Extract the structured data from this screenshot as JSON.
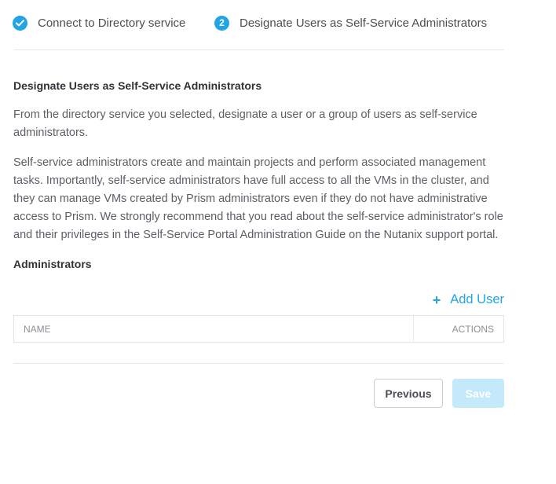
{
  "stepper": {
    "steps": [
      {
        "label": "Connect to Directory service",
        "state": "complete",
        "icon": "checkmark-icon"
      },
      {
        "number": "2",
        "label": "Designate Users as Self-Service Administrators",
        "state": "active"
      }
    ]
  },
  "section": {
    "title": "Designate Users as Self-Service Administrators",
    "paragraphs": [
      "From the directory service you selected, designate a user or a group of users as self-service administrators.",
      "Self-service administrators create and maintain projects and perform associated management tasks. Importantly, self-service administrators have full access to all the VMs in the cluster, and they can manage VMs created by Prism administrators even if they do not have administrative access to Prism. We strongly recommend that you read about the self-service administrator's role and their privileges in the Self-Service Portal Administration Guide on the Nutanix support portal."
    ]
  },
  "administrators": {
    "title": "Administrators",
    "add_user_icon": "+",
    "add_user_label": "Add User",
    "table": {
      "columns": [
        "NAME",
        "ACTIONS"
      ],
      "rows": []
    }
  },
  "footer": {
    "previous_label": "Previous",
    "save_label": "Save"
  },
  "colors": {
    "accent": "#22a5e3",
    "save_disabled": "#c3e9fb"
  }
}
